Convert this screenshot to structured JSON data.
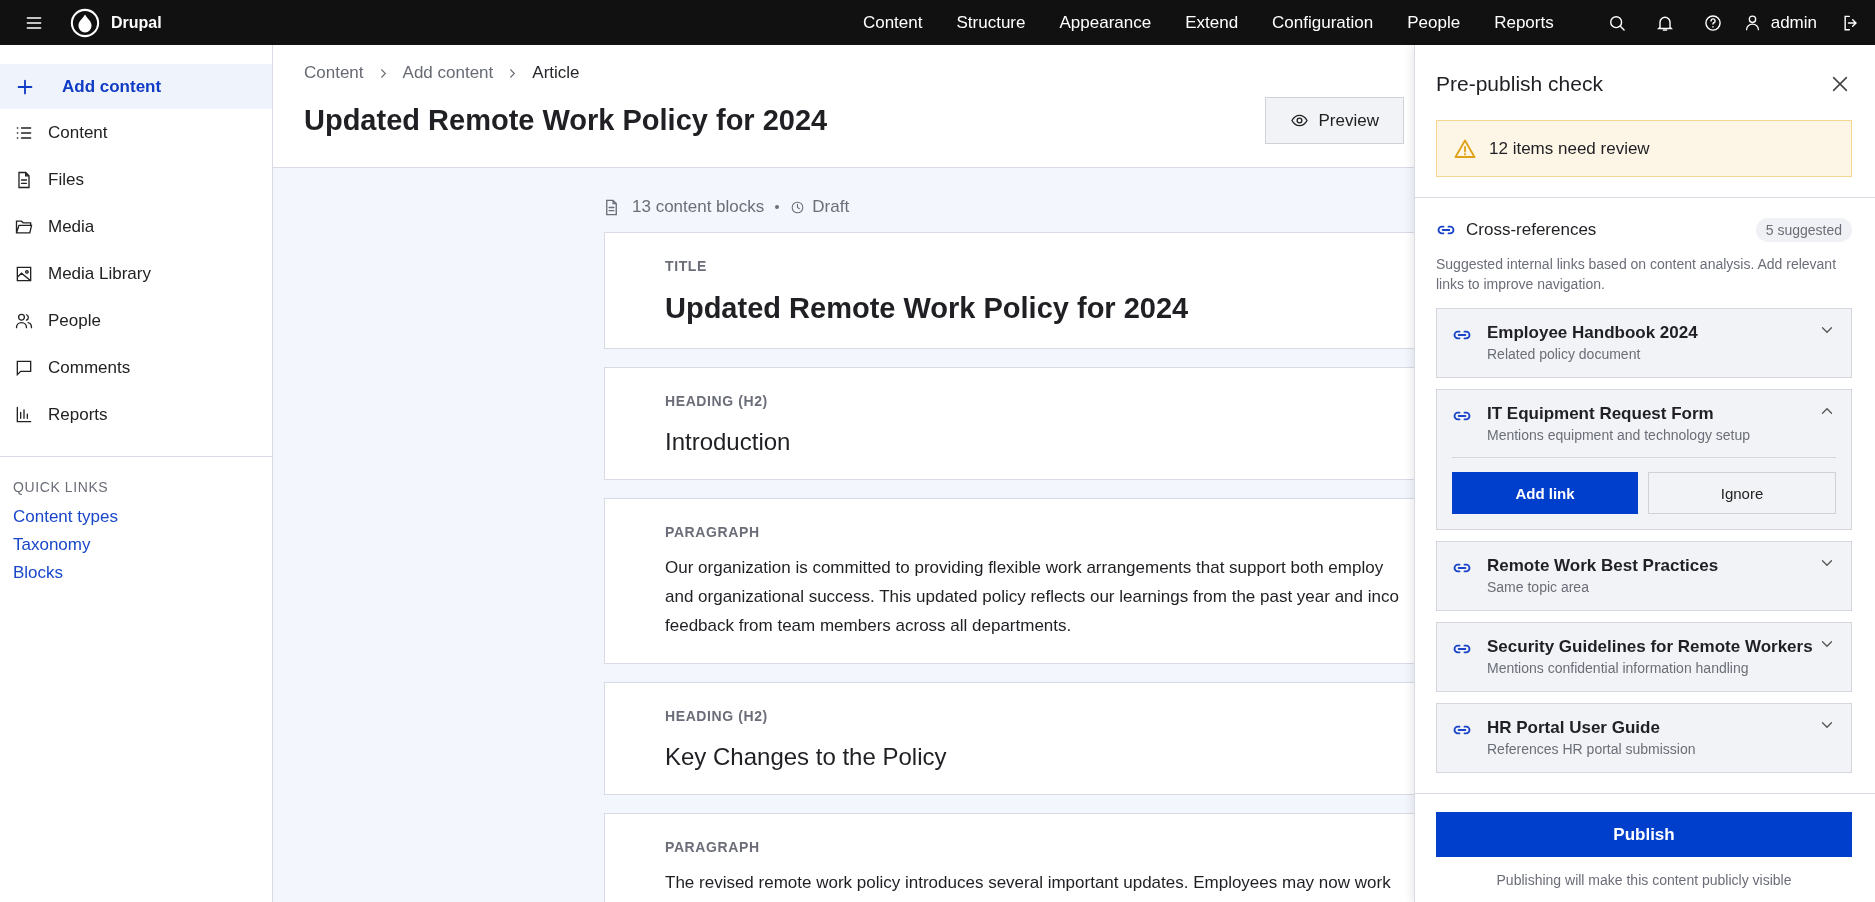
{
  "top_bar": {
    "brand": "Drupal",
    "nav": [
      "Content",
      "Structure",
      "Appearance",
      "Extend",
      "Configuration",
      "People",
      "Reports"
    ],
    "user": "admin"
  },
  "sidebar": {
    "items": [
      {
        "label": "Add content",
        "selected": true
      },
      {
        "label": "Content",
        "selected": false
      },
      {
        "label": "Files",
        "selected": false
      },
      {
        "label": "Media",
        "selected": false
      },
      {
        "label": "Media Library",
        "selected": false
      },
      {
        "label": "People",
        "selected": false
      },
      {
        "label": "Comments",
        "selected": false
      },
      {
        "label": "Reports",
        "selected": false
      }
    ],
    "quick_links": {
      "heading": "QUICK LINKS",
      "links": [
        "Content types",
        "Taxonomy",
        "Blocks"
      ]
    }
  },
  "header": {
    "breadcrumb": [
      "Content",
      "Add content",
      "Article"
    ],
    "title": "Updated Remote Work Policy for 2024",
    "buttons": [
      "Preview"
    ]
  },
  "editor": {
    "meta": {
      "blocks": "13 content blocks",
      "status": "Draft"
    },
    "blocks": [
      {
        "kind": "title",
        "label": "TITLE",
        "lines": [
          "Updated Remote Work Policy for 2024"
        ]
      },
      {
        "kind": "heading",
        "label": "HEADING (H2)",
        "lines": [
          "Introduction"
        ]
      },
      {
        "kind": "paragraph",
        "label": "PARAGRAPH",
        "lines": [
          "Our organization is committed to providing flexible work arrangements that support both employ",
          "and organizational success. This updated policy reflects our learnings from the past year and inco",
          "feedback from team members across all departments."
        ]
      },
      {
        "kind": "heading",
        "label": "HEADING (H2)",
        "lines": [
          "Key Changes to the Policy"
        ]
      },
      {
        "kind": "paragraph",
        "label": "PARAGRAPH",
        "lines": [
          "The revised remote work policy introduces several important updates. Employees may now work"
        ]
      }
    ]
  },
  "panel": {
    "title": "Pre-publish check",
    "alert": "12 items need review",
    "section": {
      "title": "Cross-references",
      "badge": "5 suggested",
      "description": "Suggested internal links based on content analysis. Add relevant links to improve navigation.",
      "items": [
        {
          "title": "Employee Handbook 2024",
          "reason": "Related policy document",
          "expanded": false
        },
        {
          "title": "IT Equipment Request Form",
          "reason": "Mentions equipment and technology setup",
          "expanded": true
        },
        {
          "title": "Remote Work Best Practices",
          "reason": "Same topic area",
          "expanded": false
        },
        {
          "title": "Security Guidelines for Remote Workers",
          "reason": "Mentions confidential information handling",
          "expanded": false
        },
        {
          "title": "HR Portal User Guide",
          "reason": "References HR portal submission",
          "expanded": false
        }
      ],
      "actions": [
        "Add link",
        "Ignore"
      ]
    },
    "publish_button": "Publish",
    "footnote": "Publishing will make this content publicly visible"
  }
}
